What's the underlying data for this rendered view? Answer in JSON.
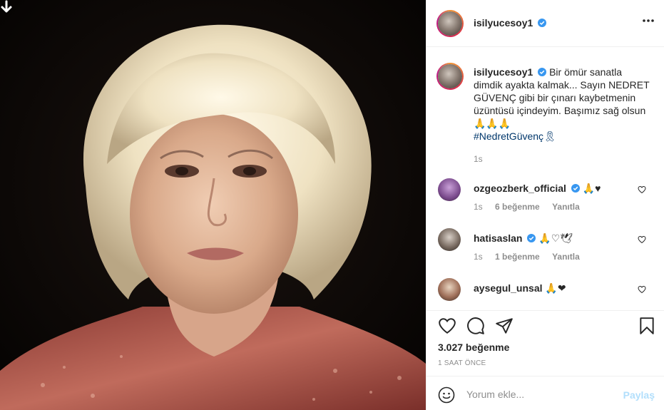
{
  "post": {
    "username": "isilyucesoy1",
    "image_alt": "Portrait of a woman with white hair"
  },
  "caption": {
    "username": "isilyucesoy1",
    "text": "Bir ömür sanatla dimdik ayakta kalmak... Sayın NEDRET GÜVENÇ gibi bir çınarı kaybetmenin üzüntüsü içindeyim. Başımız sağ olsun 🙏🙏🙏",
    "hashtag": "#NedretGüvenç🎗",
    "age": "1s"
  },
  "comments": [
    {
      "username": "ozgeozberk_official",
      "verified": true,
      "text": "🙏♥",
      "age": "1s",
      "likes": "6 beğenme",
      "reply": "Yanıtla"
    },
    {
      "username": "hatisaslan",
      "verified": true,
      "text": "🙏♡🕊",
      "age": "1s",
      "likes": "1 beğenme",
      "reply": "Yanıtla"
    },
    {
      "username": "aysegul_unsal",
      "verified": false,
      "text": "🙏❤",
      "age": "",
      "likes": "",
      "reply": ""
    }
  ],
  "footer": {
    "likes": "3.027 beğenme",
    "time": "1 SAAT ÖNCE",
    "comment_placeholder": "Yorum ekle...",
    "post_label": "Paylaş"
  },
  "icons": {
    "download": "download-arrow-icon",
    "more": "more-options-icon",
    "like": "heart-icon",
    "comment": "comment-icon",
    "share": "share-icon",
    "save": "bookmark-icon",
    "emoji": "emoji-icon",
    "verified": "verified-badge-icon"
  },
  "colors": {
    "verified": "#3897f0",
    "link": "#00376b",
    "muted": "#8e8e8e",
    "post_disabled": "#b2dffc",
    "heart_red": "#ed4956"
  }
}
